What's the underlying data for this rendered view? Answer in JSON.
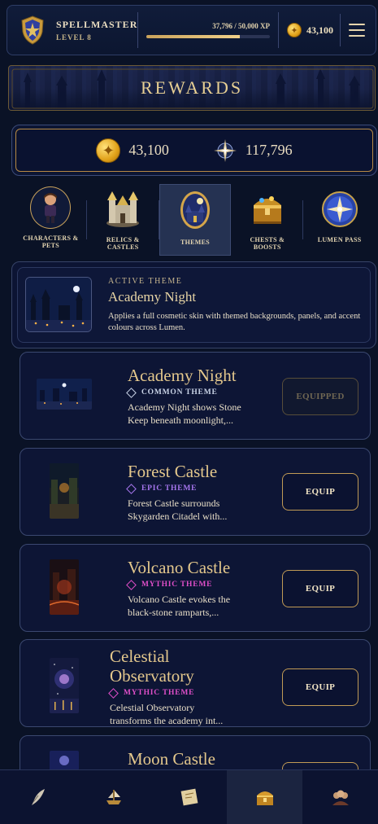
{
  "header": {
    "player_name": "SPELLMASTER",
    "level": "LEVEL 8",
    "xp_text": "37,796 / 50,000 XP",
    "xp_progress": 0.756,
    "coins": "43,100",
    "crest_icon": "shield-crest-icon",
    "menu_icon": "hamburger-menu-icon"
  },
  "banner": {
    "title": "REWARDS"
  },
  "currency": {
    "coins": "43,100",
    "lumens": "117,796",
    "coin_icon": "gold-coin-icon",
    "lumen_icon": "lumen-star-icon"
  },
  "categories": [
    {
      "label_line1": "CHARACTERS &",
      "label_line2": "PETS",
      "icon": "character-icon",
      "active": false
    },
    {
      "label_line1": "RELICS &",
      "label_line2": "CASTLES",
      "icon": "castle-icon",
      "active": false
    },
    {
      "label_line1": "THEMES",
      "label_line2": "",
      "icon": "theme-castle-icon",
      "active": true
    },
    {
      "label_line1": "CHESTS &",
      "label_line2": "BOOSTS",
      "icon": "chest-icon",
      "active": false
    },
    {
      "label_line1": "LUMEN PASS",
      "label_line2": "",
      "icon": "lumen-pass-icon",
      "active": false
    }
  ],
  "active_theme": {
    "label": "ACTIVE THEME",
    "title": "Academy Night",
    "description": "Applies a full cosmetic skin with themed backgrounds, panels, and accent colours across Lumen."
  },
  "themes": [
    {
      "title": "Academy Night",
      "rarity": "COMMON THEME",
      "rarity_color": "#c9d3e6",
      "desc_line1": "Academy Night shows Stone",
      "desc_line2": "Keep beneath moonlight,...",
      "button": "EQUIPPED"
    },
    {
      "title": "Forest Castle",
      "rarity": "EPIC THEME",
      "rarity_color": "#a877f0",
      "desc_line1": "Forest Castle surrounds",
      "desc_line2": "Skygarden Citadel with...",
      "button": "EQUIP"
    },
    {
      "title": "Volcano Castle",
      "rarity": "MYTHIC THEME",
      "rarity_color": "#e04fc9",
      "desc_line1": "Volcano Castle evokes the",
      "desc_line2": "black-stone ramparts,...",
      "button": "EQUIP"
    },
    {
      "title_line1": "Celestial",
      "title_line2": "Observatory",
      "rarity": "MYTHIC THEME",
      "rarity_color": "#e04fc9",
      "desc_line1": "Celestial Observatory",
      "desc_line2": "transforms the academy int...",
      "button": "EQUIP"
    },
    {
      "title": "Moon Castle"
    }
  ],
  "bottom_nav": [
    {
      "icon": "quill-icon",
      "active": false
    },
    {
      "icon": "ship-icon",
      "active": false
    },
    {
      "icon": "scroll-map-icon",
      "active": false
    },
    {
      "icon": "treasure-chest-icon",
      "active": true
    },
    {
      "icon": "friends-group-icon",
      "active": false
    }
  ]
}
